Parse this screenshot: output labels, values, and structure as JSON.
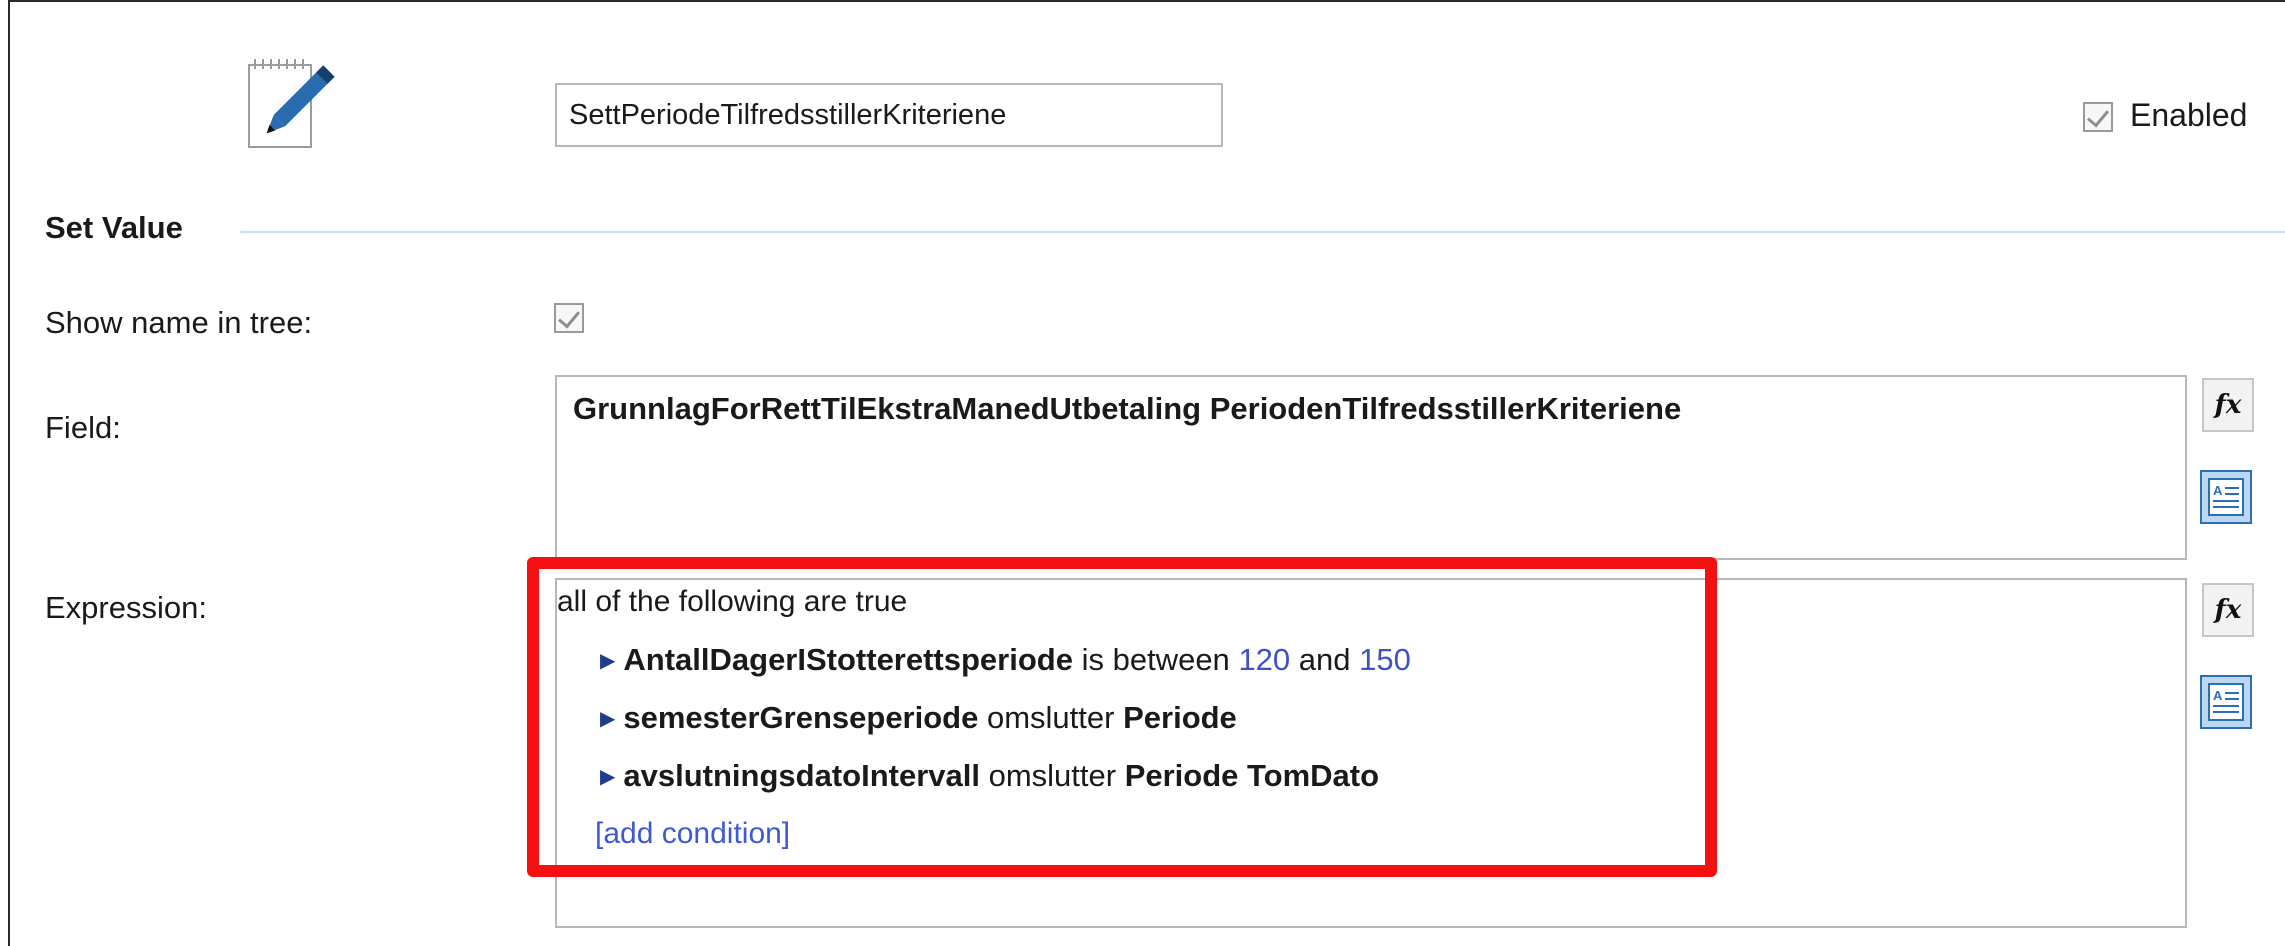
{
  "node": {
    "icon": "edit-pencil-icon",
    "name_value": "SettPeriodeTilfredsstillerKriteriene",
    "enabled_label": "Enabled",
    "enabled_checked": true
  },
  "section": {
    "title": "Set Value"
  },
  "show_name": {
    "label": "Show name in tree:",
    "checked": true
  },
  "field": {
    "label": "Field:",
    "value": "GrunnlagForRettTilEkstraManedUtbetaling PeriodenTilfredsstillerKriteriene"
  },
  "expression": {
    "label": "Expression:",
    "header": "all of the following are true",
    "conditions": [
      {
        "subject": "AntallDagerIStotterettsperiode",
        "op": "is between",
        "low": "120",
        "and": "and",
        "high": "150"
      },
      {
        "subject": "semesterGrenseperiode",
        "op": "omslutter",
        "object": "Periode"
      },
      {
        "subject": "avslutningsdatoIntervall",
        "op": "omslutter",
        "object": "Periode TomDato"
      }
    ],
    "add_condition": "[add condition]"
  },
  "buttons": {
    "fx_label": "fx",
    "fx_icon": "function-icon",
    "doc_icon": "text-document-icon"
  },
  "colors": {
    "highlight": "#f41010",
    "number": "#3f51c7",
    "link": "#3f5ad0",
    "section_rule": "#cbdff0"
  }
}
